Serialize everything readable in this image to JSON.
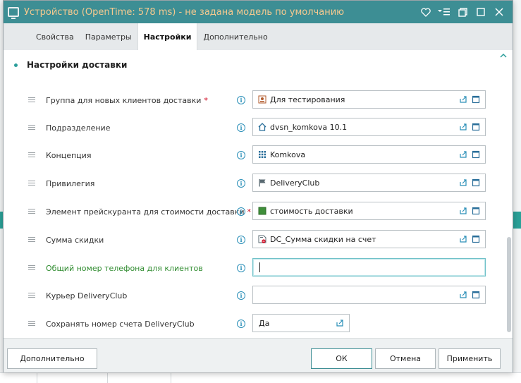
{
  "window": {
    "title": "Устройство (OpenTime: 578 ms) - не задана модель по умолчанию"
  },
  "tabs": [
    {
      "label": "Свойства"
    },
    {
      "label": "Параметры"
    },
    {
      "label": "Настройки",
      "active": true
    },
    {
      "label": "Дополнительно"
    }
  ],
  "section": {
    "title": "Настройки доставки"
  },
  "rows": [
    {
      "label": "Группа для новых клиентов доставки",
      "required": "*",
      "value": "Для тестирования",
      "icon": "contact-card-icon"
    },
    {
      "label": "Подразделение",
      "value": "dvsn_komkova 10.1",
      "icon": "home-icon"
    },
    {
      "label": "Концепция",
      "value": "Komkova",
      "icon": "grid-icon"
    },
    {
      "label": "Привилегия",
      "value": "DeliveryClub",
      "icon": "flag-icon"
    },
    {
      "label": "Элемент прейскуранта для стоимости доставки",
      "required": "*",
      "value": "стоимость доставки",
      "icon": "green-square-icon"
    },
    {
      "label": "Сумма скидки",
      "value": "DC_Сумма скидки на счет",
      "icon": "discount-icon"
    },
    {
      "label": "Общий номер телефона для клиентов",
      "value": ""
    },
    {
      "label": "Курьер DeliveryClub",
      "value": ""
    },
    {
      "label": "Сохранять номер счета DeliveryClub",
      "value": "Да"
    }
  ],
  "footer": {
    "more_label": "Дополнительно",
    "ok_label": "ОК",
    "cancel_label": "Отмена",
    "apply_label": "Применить"
  },
  "colors": {
    "titlebar": "#3d8e94",
    "title_text": "#f5c98f",
    "accent": "#2a9d9a",
    "required": "#d0021b",
    "green_label": "#2e8b2e"
  }
}
